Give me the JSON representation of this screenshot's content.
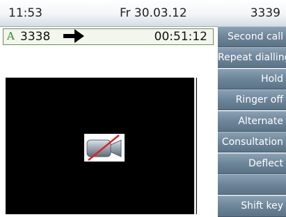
{
  "status_bar": {
    "time": "11:53",
    "date": "Fr 30.03.12",
    "extension": "3339"
  },
  "active_call": {
    "status_letter": "A",
    "number": "3338",
    "direction_icon": "right-arrow-icon",
    "duration": "00:51:12"
  },
  "video": {
    "icon": "camera-off-icon"
  },
  "softkeys": [
    {
      "label": "Second call"
    },
    {
      "label": "Repeat dialling"
    },
    {
      "label": "Hold"
    },
    {
      "label": "Ringer off"
    },
    {
      "label": "Alternate"
    },
    {
      "label": "Consultation"
    },
    {
      "label": "Deflect"
    },
    {
      "label": ""
    },
    {
      "label": "Shift key"
    }
  ],
  "colors": {
    "softkey_bg": "#6d8599",
    "call_status": "#2c8a2c",
    "video_bg": "#000000"
  }
}
